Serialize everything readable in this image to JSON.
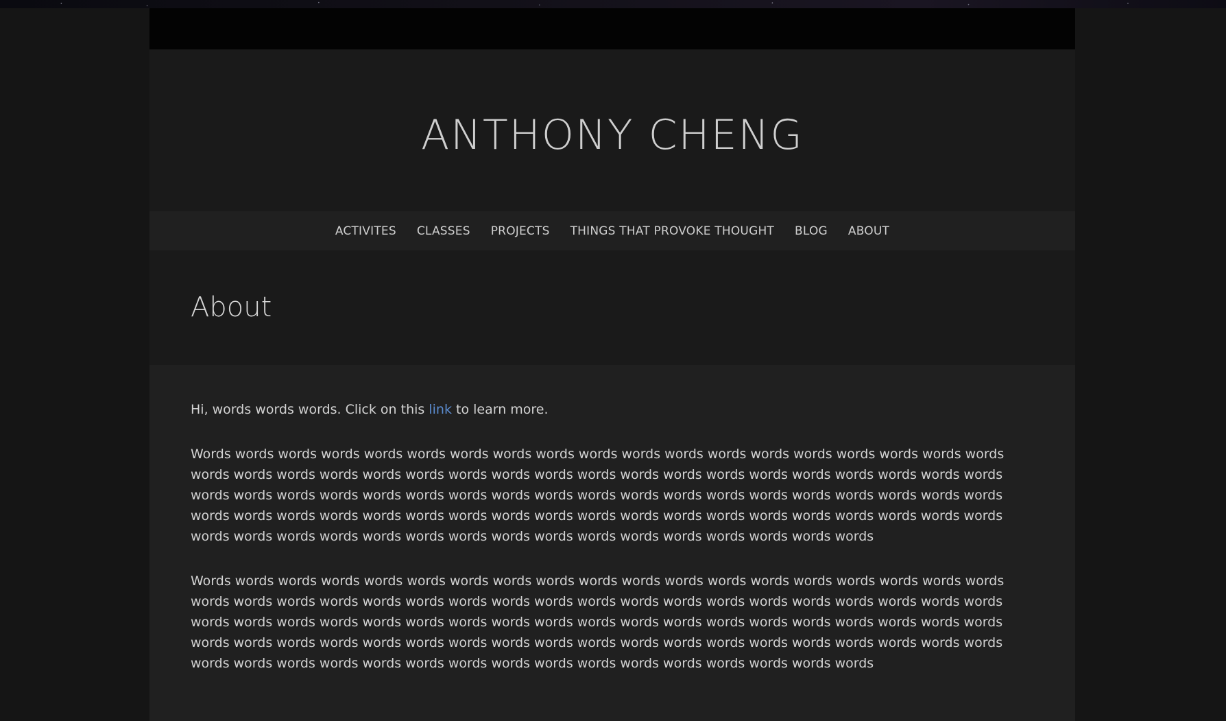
{
  "site": {
    "title": "ANTHONY CHENG"
  },
  "nav": {
    "items": [
      {
        "label": "ACTIVITES"
      },
      {
        "label": "CLASSES"
      },
      {
        "label": "PROJECTS"
      },
      {
        "label": "THINGS THAT PROVOKE THOUGHT"
      },
      {
        "label": "BLOG"
      },
      {
        "label": "ABOUT"
      }
    ]
  },
  "page": {
    "title": "About"
  },
  "content": {
    "intro_before": "Hi, words words words. Click on this ",
    "intro_link": "link",
    "intro_after": " to learn more.",
    "paragraph1": "Words words words words words words words words words words words words words words words words words words words words words words words words words words words words words words words words words words words words words words words words words words words words words words words words words words words words words words words words words words words words words words words words words words words words words words words words words words words words words words words words words words words words words words words words words words words words",
    "paragraph2": "Words words words words words words words words words words words words words words words words words words words words words words words words words words words words words words words words words words words words words words words words words words words words words words words words words words words words words words words words words words words words words words words words words words words words words words words words words words words words words words words words words words words words words words words words words words words words"
  },
  "colors": {
    "background": "#151515",
    "panel": "#1a1a1a",
    "nav_bar": "#202020",
    "content_bg": "#202020",
    "text": "#d2d2d2",
    "link": "#5b8ccf"
  }
}
